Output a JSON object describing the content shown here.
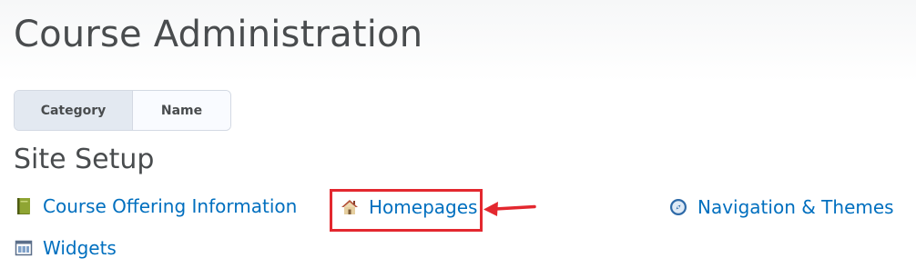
{
  "header": {
    "title": "Course Administration"
  },
  "view_toggle": {
    "options": [
      {
        "label": "Category",
        "selected": true
      },
      {
        "label": "Name",
        "selected": false
      }
    ]
  },
  "sections": [
    {
      "heading": "Site Setup",
      "tools": [
        {
          "label": "Course Offering Information",
          "icon": "book-icon"
        },
        {
          "label": "Homepages",
          "icon": "home-icon",
          "highlighted": true
        },
        {
          "label": "Navigation & Themes",
          "icon": "compass-icon"
        },
        {
          "label": "Widgets",
          "icon": "widgets-icon"
        }
      ]
    }
  ],
  "colors": {
    "link": "#006fbf",
    "text": "#494c4e",
    "annotation": "#e3282f",
    "toggle_selected_bg": "#e3e9f1"
  }
}
